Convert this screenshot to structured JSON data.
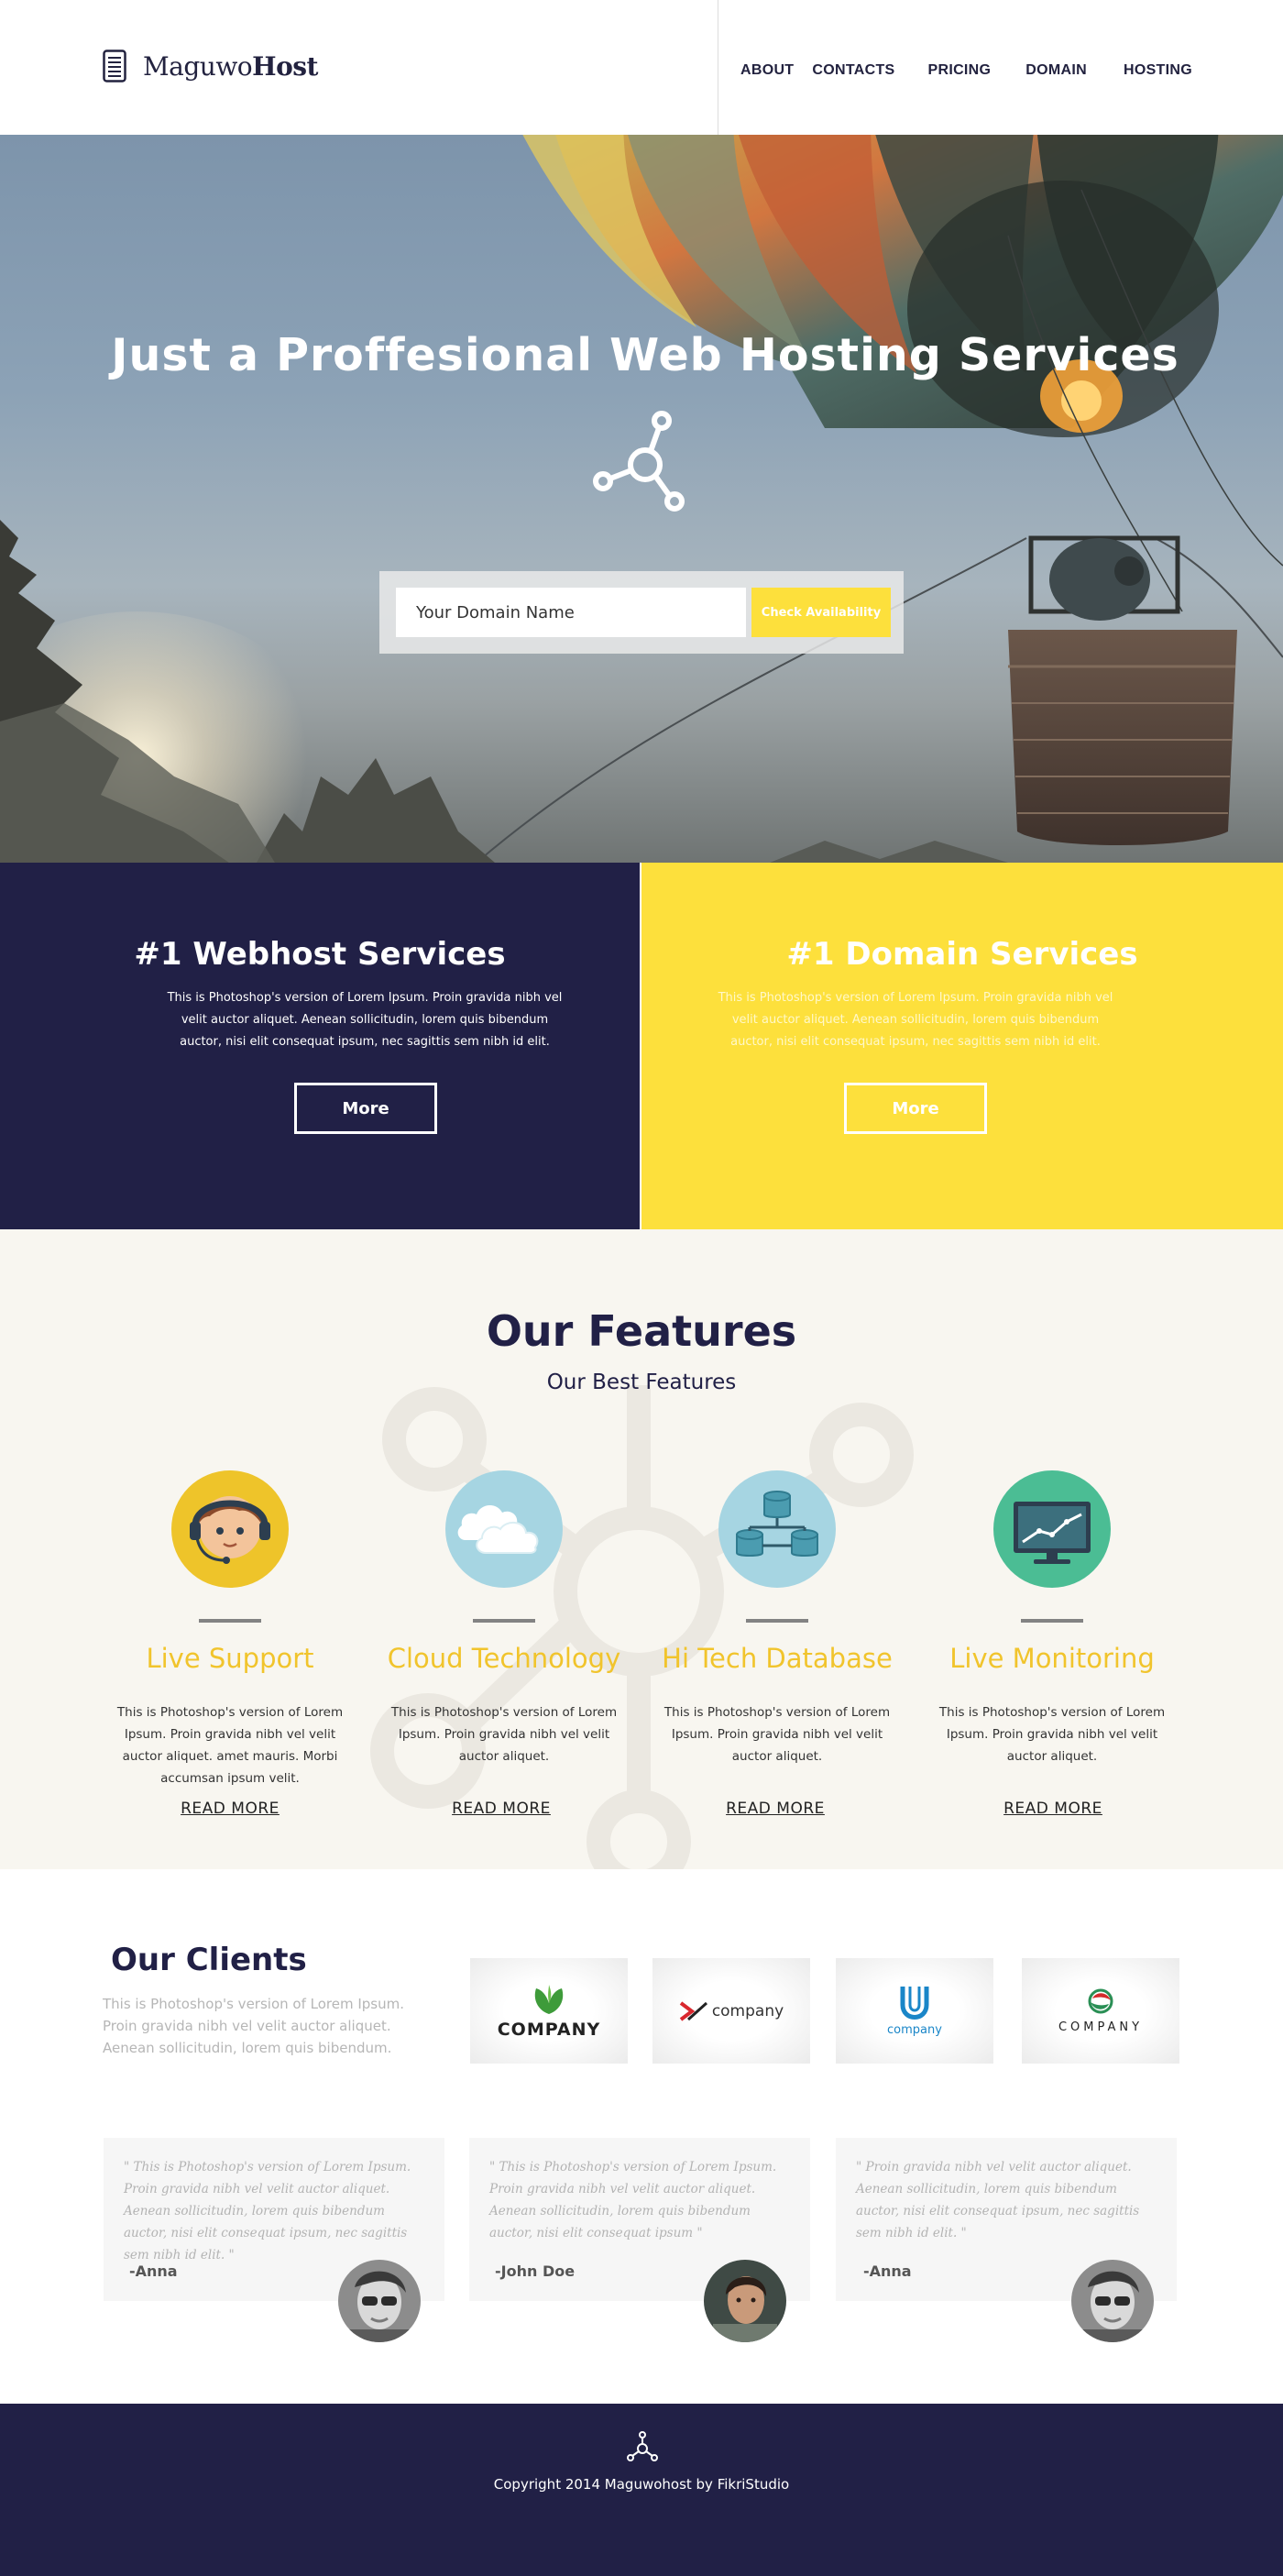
{
  "header": {
    "logo_light": "Maguwo",
    "logo_bold": "Host",
    "logo_icon": "server-icon",
    "nav": [
      {
        "label": "ABOUT"
      },
      {
        "label": "CONTACTS"
      },
      {
        "label": "PRICING"
      },
      {
        "label": "DOMAIN"
      },
      {
        "label": "HOSTING"
      }
    ]
  },
  "hero": {
    "title": "Just a Proffesional Web Hosting Services",
    "icon": "share-hub-icon",
    "search": {
      "placeholder": "Your Domain Name",
      "button_label": "Check Availability"
    }
  },
  "services": [
    {
      "title": "#1 Webhost Services",
      "text": "This is Photoshop's version  of Lorem Ipsum. Proin gravida nibh vel velit auctor aliquet. Aenean sollicitudin, lorem quis bibendum auctor, nisi elit consequat ipsum, nec sagittis sem nibh id elit.",
      "button_label": "More",
      "bg_color": "#212046"
    },
    {
      "title": "#1 Domain Services",
      "text": "This is Photoshop's version  of Lorem Ipsum. Proin gravida nibh vel velit auctor aliquet. Aenean sollicitudin, lorem quis bibendum auctor, nisi elit consequat ipsum, nec sagittis sem nibh id elit.",
      "button_label": "More",
      "bg_color": "#fde03c"
    }
  ],
  "features": {
    "title": "Our Features",
    "subtitle": "Our Best Features",
    "items": [
      {
        "icon": "support-agent-icon",
        "name": "Live Support",
        "text": "This is Photoshop's version  of Lorem Ipsum. Proin gravida nibh vel velit auctor aliquet. amet mauris. Morbi accumsan ipsum velit.",
        "read_more": "READ MORE",
        "circle_color": "#eec42a"
      },
      {
        "icon": "cloud-icon",
        "name": "Cloud Technology",
        "text": "This is Photoshop's version  of Lorem Ipsum. Proin gravida nibh vel velit auctor aliquet.",
        "read_more": "READ MORE",
        "circle_color": "#a6d5e2"
      },
      {
        "icon": "database-icon",
        "name": "Hi Tech Database",
        "text": "This is Photoshop's version  of Lorem Ipsum. Proin gravida nibh vel velit auctor aliquet.",
        "read_more": "READ MORE",
        "circle_color": "#a6d5e2"
      },
      {
        "icon": "monitor-chart-icon",
        "name": "Live Monitoring",
        "text": "This is Photoshop's version  of Lorem Ipsum. Proin gravida nibh vel velit auctor aliquet.",
        "read_more": "READ MORE",
        "circle_color": "#4bbd94"
      }
    ]
  },
  "clients": {
    "title": "Our Clients",
    "text": "This is Photoshop's version  of Lorem Ipsum. Proin gravida nibh vel velit auctor aliquet. Aenean sollicitudin, lorem quis bibendum.",
    "logos": [
      {
        "icon": "leaf-logo-icon",
        "label": "COMPANY"
      },
      {
        "icon": "x-logo-icon",
        "label": "company"
      },
      {
        "icon": "u-logo-icon",
        "label": "company"
      },
      {
        "icon": "swirl-logo-icon",
        "label": "COMPANY"
      }
    ]
  },
  "testimonials": [
    {
      "quote": "\" This is Photoshop's version  of Lorem Ipsum. Proin gravida nibh vel velit auctor aliquet. Aenean sollicitudin, lorem quis bibendum auctor, nisi elit consequat ipsum, nec sagittis sem nibh id elit. \"",
      "name": "-Anna"
    },
    {
      "quote": "\" This is Photoshop's version  of Lorem Ipsum. Proin gravida nibh vel velit auctor aliquet. Aenean sollicitudin, lorem quis bibendum auctor, nisi elit consequat ipsum  \"",
      "name": "-John Doe"
    },
    {
      "quote": "\" Proin gravida nibh vel velit auctor aliquet. Aenean sollicitudin, lorem quis bibendum auctor, nisi elit consequat ipsum, nec sagittis sem nibh id elit. \"",
      "name": "-Anna"
    }
  ],
  "footer": {
    "icon": "share-hub-icon",
    "copyright": "Copyright 2014 Maguwohost by FikriStudio"
  }
}
